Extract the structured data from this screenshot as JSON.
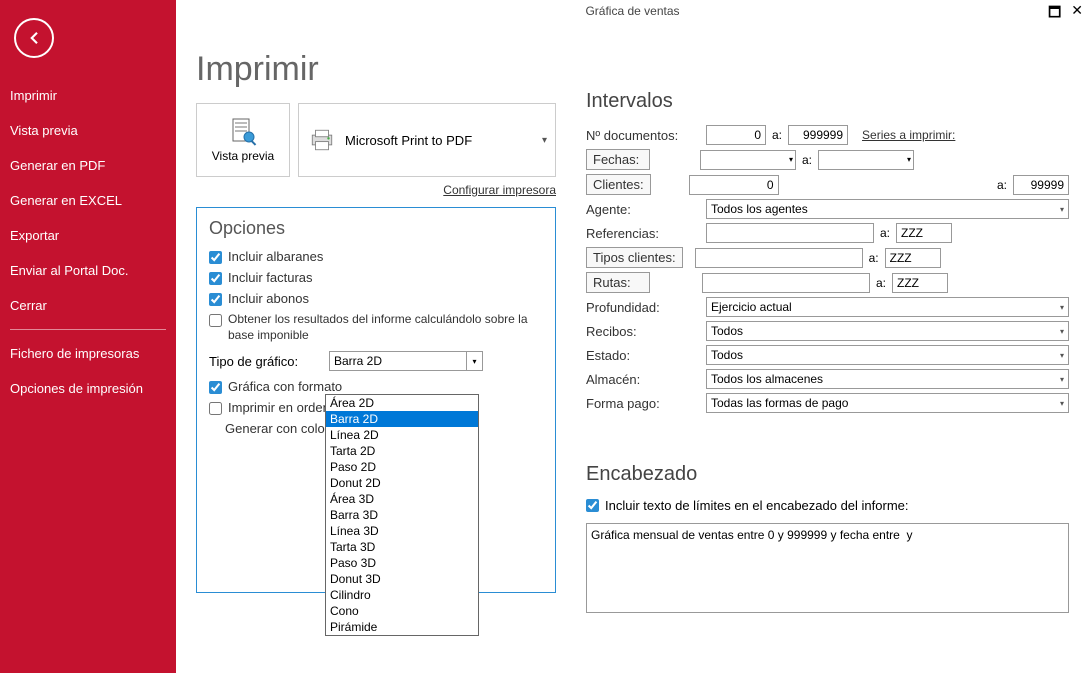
{
  "window": {
    "title": "Gráfica de ventas"
  },
  "sidebar": {
    "items": [
      "Imprimir",
      "Vista previa",
      "Generar en PDF",
      "Generar en EXCEL",
      "Exportar",
      "Enviar al Portal Doc.",
      "Cerrar"
    ],
    "items2": [
      "Fichero de impresoras",
      "Opciones de impresión"
    ]
  },
  "main": {
    "title": "Imprimir",
    "vistaPrevia": "Vista previa",
    "printer": "Microsoft Print to PDF",
    "configLink": "Configurar impresora"
  },
  "opciones": {
    "title": "Opciones",
    "incAlbaranes": "Incluir albaranes",
    "incFacturas": "Incluir facturas",
    "incAbonos": "Incluir abonos",
    "obtener": "Obtener los resultados del informe calculándolo sobre la base imponible",
    "tipoLabel": "Tipo de gráfico:",
    "tipoValue": "Barra 2D",
    "graficaFormato": "Gráfica con formato",
    "imprimirOrden": "Imprimir en orden i",
    "generarColores": "Generar con colores",
    "tipoList": [
      "Área 2D",
      "Barra 2D",
      "Línea 2D",
      "Tarta 2D",
      "Paso 2D",
      "Donut 2D",
      "Área 3D",
      "Barra 3D",
      "Línea 3D",
      "Tarta 3D",
      "Paso 3D",
      "Donut 3D",
      "Cilindro",
      "Cono",
      "Pirámide"
    ]
  },
  "intervalos": {
    "title": "Intervalos",
    "numDoc": "Nº documentos:",
    "numDocFrom": "0",
    "aLabel": "a:",
    "numDocTo": "999999",
    "seriesLink": "Series a imprimir:",
    "fechas": "Fechas:",
    "clientes": "Clientes:",
    "clientesFrom": "0",
    "clientesTo": "99999",
    "agente": "Agente:",
    "agenteVal": "Todos los agentes",
    "referencias": "Referencias:",
    "refTo": "ZZZ",
    "tiposClientes": "Tipos clientes:",
    "tiposTo": "ZZZ",
    "rutas": "Rutas:",
    "rutasTo": "ZZZ",
    "profundidad": "Profundidad:",
    "profVal": "Ejercicio actual",
    "recibos": "Recibos:",
    "recibosVal": "Todos",
    "estado": "Estado:",
    "estadoVal": "Todos",
    "almacen": "Almacén:",
    "almacenVal": "Todos los almacenes",
    "formaPago": "Forma pago:",
    "formaVal": "Todas las formas de pago"
  },
  "encabezado": {
    "title": "Encabezado",
    "checkLabel": "Incluir texto de límites en el encabezado del informe:",
    "text": "Gráfica mensual de ventas entre 0 y 999999 y fecha entre  y "
  }
}
